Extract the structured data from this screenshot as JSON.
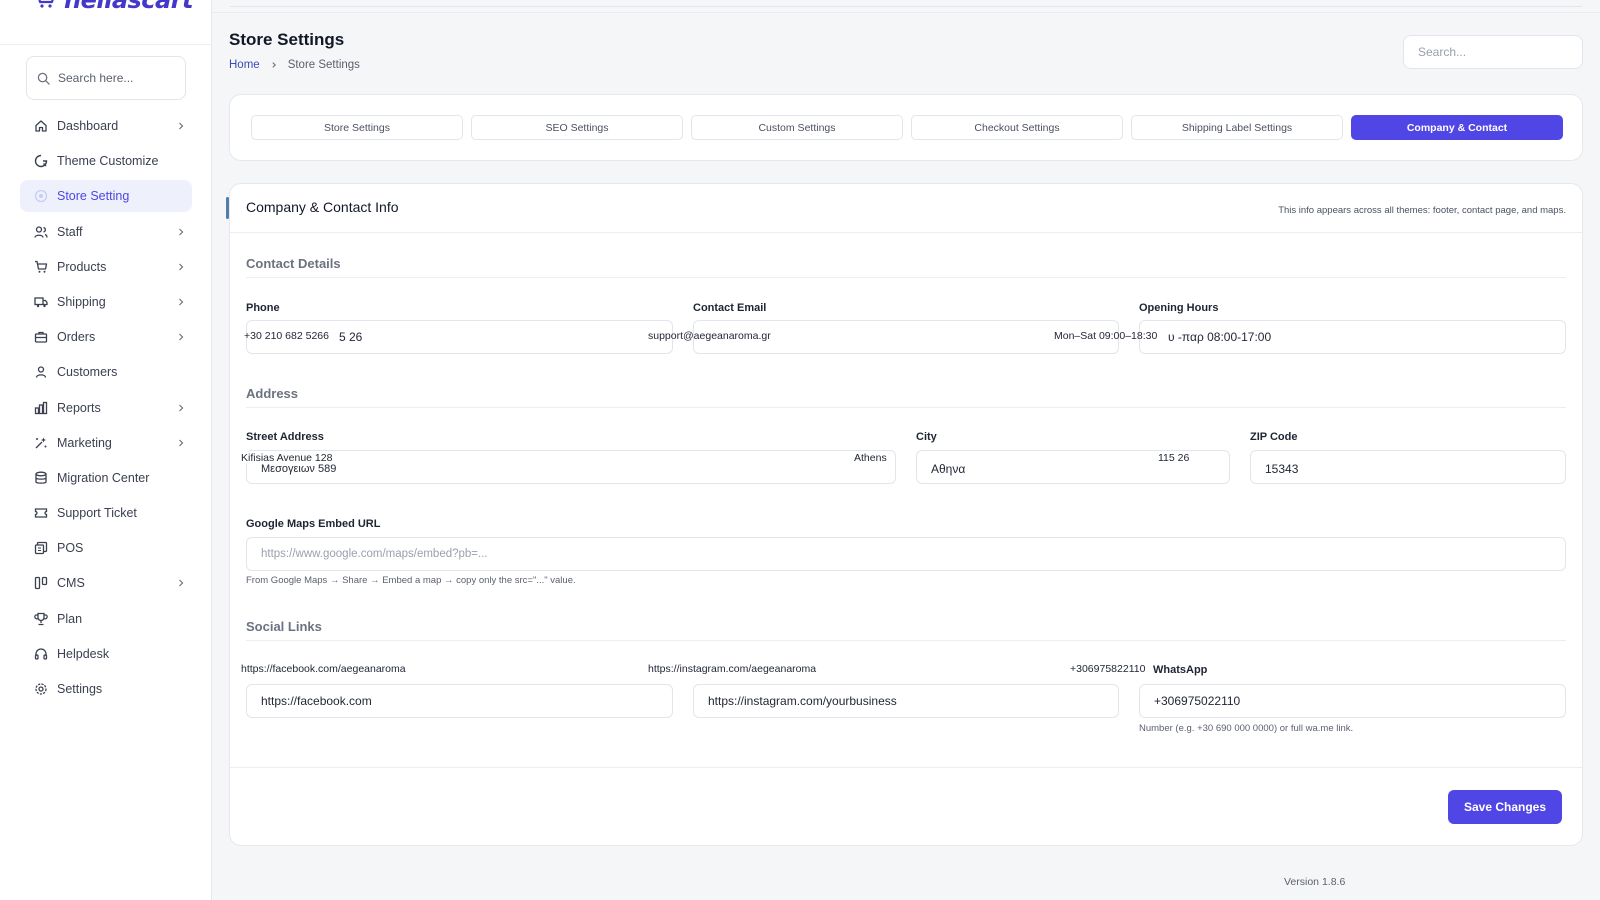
{
  "brand": {
    "name": "hellascart"
  },
  "sidebar": {
    "search_placeholder": "Search here...",
    "items": [
      {
        "label": "Dashboard",
        "icon": "home-icon",
        "chevron": true
      },
      {
        "label": "Theme Customize",
        "icon": "palette-icon",
        "chevron": false
      },
      {
        "label": "Store Setting",
        "icon": "store-icon",
        "chevron": false,
        "active": true
      },
      {
        "label": "Staff",
        "icon": "users-icon",
        "chevron": true
      },
      {
        "label": "Products",
        "icon": "cart-icon",
        "chevron": true
      },
      {
        "label": "Shipping",
        "icon": "truck-icon",
        "chevron": true
      },
      {
        "label": "Orders",
        "icon": "briefcase-icon",
        "chevron": true
      },
      {
        "label": "Customers",
        "icon": "user-icon",
        "chevron": false
      },
      {
        "label": "Reports",
        "icon": "bar-chart-icon",
        "chevron": true
      },
      {
        "label": "Marketing",
        "icon": "sparkle-icon",
        "chevron": true
      },
      {
        "label": "Migration Center",
        "icon": "database-icon",
        "chevron": false
      },
      {
        "label": "Support Ticket",
        "icon": "ticket-icon",
        "chevron": false
      },
      {
        "label": "POS",
        "icon": "register-icon",
        "chevron": false
      },
      {
        "label": "CMS",
        "icon": "layout-icon",
        "chevron": true
      },
      {
        "label": "Plan",
        "icon": "trophy-icon",
        "chevron": false
      },
      {
        "label": "Helpdesk",
        "icon": "headset-icon",
        "chevron": false
      },
      {
        "label": "Settings",
        "icon": "gear-icon",
        "chevron": false
      }
    ]
  },
  "header": {
    "title": "Store Settings",
    "breadcrumb": {
      "home": "Home",
      "current": "Store Settings"
    },
    "search_placeholder": "Search..."
  },
  "tabs": [
    {
      "label": "Store Settings"
    },
    {
      "label": "SEO Settings"
    },
    {
      "label": "Custom Settings"
    },
    {
      "label": "Checkout Settings"
    },
    {
      "label": "Shipping Label Settings"
    },
    {
      "label": "Company & Contact",
      "active": true
    }
  ],
  "card": {
    "title": "Company & Contact Info",
    "note": "This info appears across all themes: footer, contact page, and maps."
  },
  "contact": {
    "section": "Contact Details",
    "phone": {
      "label": "Phone",
      "overlay": "+30 210 682 5266",
      "value": "5 26"
    },
    "email": {
      "label": "Contact Email",
      "overlay": "support@aegeanaroma.gr",
      "value": ""
    },
    "hours": {
      "label": "Opening Hours",
      "overlay": "Mon–Sat 09:00–18:30",
      "value": "υ -παρ 08:00-17:00"
    }
  },
  "address": {
    "section": "Address",
    "street": {
      "label": "Street Address",
      "overlay": "Kifisias Avenue 128",
      "overlay2": "Athens",
      "value": "Μεσογειων 589"
    },
    "city": {
      "label": "City",
      "overlay": "115 26",
      "value": "Αθηνα"
    },
    "zip": {
      "label": "ZIP Code",
      "value": "15343"
    },
    "maps": {
      "label": "Google Maps Embed URL",
      "placeholder": "https://www.google.com/maps/embed?pb=...",
      "hint": "From Google Maps → Share → Embed a map → copy only the src=\"...\" value."
    }
  },
  "social": {
    "section": "Social Links",
    "facebook": {
      "overlay": "https://facebook.com/aegeanaroma",
      "value": "https://facebook.com"
    },
    "instagram": {
      "overlay": "https://instagram.com/aegeanaroma",
      "value": "https://instagram.com/yourbusiness"
    },
    "whatsapp": {
      "overlay": "+306975822110",
      "label": "WhatsApp",
      "value": "+306975022110",
      "hint": "Number (e.g. +30 690 000 0000) or full wa.me link."
    }
  },
  "actions": {
    "save": "Save Changes"
  },
  "footer": {
    "version": "Version 1.8.6"
  },
  "colors": {
    "accent": "#4f46e5",
    "brand": "#4338ca"
  }
}
